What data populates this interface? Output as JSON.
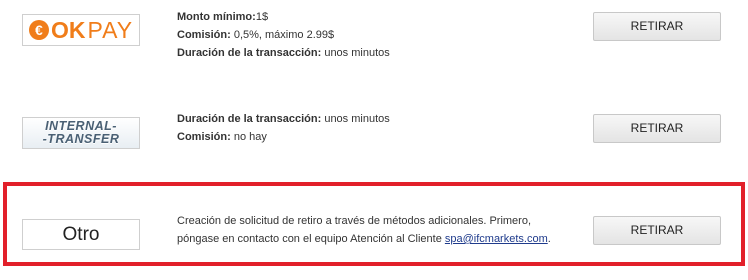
{
  "methods": [
    {
      "id": "okpay",
      "logo": {
        "ok": "OK",
        "pay": "PAY",
        "symbol": "€"
      },
      "details": [
        {
          "label": "Monto mínimo:",
          "value": "1$"
        },
        {
          "label": "Comisión:",
          "value": " 0,5%, máximo 2.99$"
        },
        {
          "label": "Duración de la transacción:",
          "value": " unos minutos"
        }
      ],
      "button_label": "RETIRAR"
    },
    {
      "id": "internal-transfer",
      "logo": {
        "line1": "INTERNAL-",
        "line2": "-TRANSFER"
      },
      "details": [
        {
          "label": "Duración de la transacción:",
          "value": " unos minutos"
        },
        {
          "label": "Comisión:",
          "value": " no hay"
        }
      ],
      "button_label": "RETIRAR"
    },
    {
      "id": "otro",
      "logo": {
        "text": "Otro"
      },
      "description_line1": "Creación de solicitud de retiro a través de métodos adicionales. Primero,",
      "description_line2_prefix": "póngase en contacto con el equipo Atención al Cliente ",
      "email": "spa@ifcmarkets.com",
      "description_line2_suffix": ".",
      "button_label": "RETIRAR",
      "highlight_color": "#e2202a"
    }
  ]
}
